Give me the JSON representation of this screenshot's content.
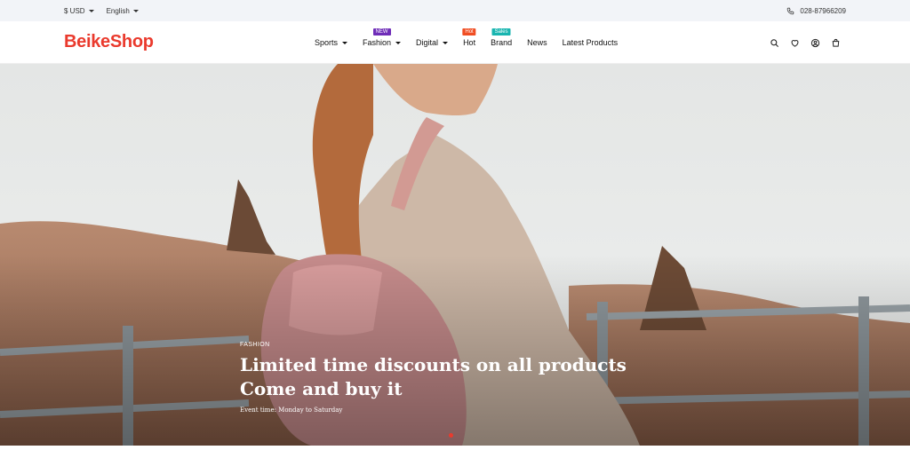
{
  "topbar": {
    "currency": "$ USD",
    "language": "English",
    "phone": "028-87966209"
  },
  "header": {
    "logo": "BeikeShop",
    "nav": [
      {
        "label": "Sports",
        "dropdown": true
      },
      {
        "label": "Fashion",
        "dropdown": true,
        "badge": "NEW",
        "badge_color": "#6f2db8"
      },
      {
        "label": "Digital",
        "dropdown": true
      },
      {
        "label": "Hot",
        "badge": "Hot",
        "badge_color": "#f04e23"
      },
      {
        "label": "Brand",
        "badge": "Sales",
        "badge_color": "#19b5b0"
      },
      {
        "label": "News"
      },
      {
        "label": "Latest Products"
      }
    ],
    "icons": [
      "search-icon",
      "heart-icon",
      "account-icon",
      "cart-icon"
    ]
  },
  "hero": {
    "tag": "FASHION",
    "title_line1": "Limited time discounts on all products",
    "title_line2": "Come and buy it",
    "subtitle": "Event time: Monday to Saturday"
  },
  "colors": {
    "brand": "#ea3a2d",
    "topbar_bg": "#f2f4f8"
  }
}
